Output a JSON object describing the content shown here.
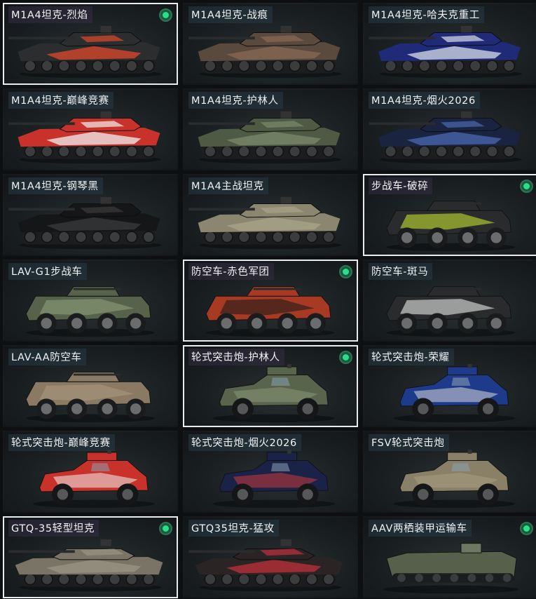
{
  "vehicles": [
    {
      "label": "M1A4坦克-烈焰",
      "selected": true,
      "owned": true,
      "type": "tank",
      "body": "#2b2d2f",
      "accent": "#e0482b",
      "icon": "tank-icon"
    },
    {
      "label": "M1A4坦克-战痕",
      "selected": false,
      "owned": false,
      "type": "tank",
      "body": "#5a4a3e",
      "accent": "#8a6a55",
      "icon": "tank-icon"
    },
    {
      "label": "M1A4坦克-哈夫克重工",
      "selected": false,
      "owned": false,
      "type": "tank",
      "body": "#1f2a78",
      "accent": "#d8dde8",
      "icon": "tank-icon"
    },
    {
      "label": "M1A4坦克-巅峰竞赛",
      "selected": false,
      "owned": false,
      "type": "tank",
      "body": "#c8322a",
      "accent": "#f0f0f0",
      "icon": "tank-icon"
    },
    {
      "label": "M1A4坦克-护林人",
      "selected": false,
      "owned": false,
      "type": "tank",
      "body": "#4f5a44",
      "accent": "#7a8a6a",
      "icon": "tank-icon"
    },
    {
      "label": "M1A4坦克-烟火2026",
      "selected": false,
      "owned": false,
      "type": "tank",
      "body": "#1a2340",
      "accent": "#4a6ab0",
      "icon": "tank-icon"
    },
    {
      "label": "M1A4坦克-钢琴黑",
      "selected": false,
      "owned": false,
      "type": "tank",
      "body": "#151617",
      "accent": "#3a3b3c",
      "icon": "tank-icon"
    },
    {
      "label": "M1A4主战坦克",
      "selected": false,
      "owned": false,
      "type": "tank",
      "body": "#8a8670",
      "accent": "#a8a488",
      "icon": "tank-icon"
    },
    {
      "label": "步战车-破碎",
      "selected": true,
      "owned": true,
      "type": "ifv",
      "body": "#2a2b2c",
      "accent": "#b8d030",
      "icon": "ifv-icon"
    },
    {
      "label": "LAV-G1步战车",
      "selected": false,
      "owned": false,
      "type": "ifv",
      "body": "#56624a",
      "accent": "#8a9a78",
      "icon": "ifv-icon"
    },
    {
      "label": "防空车-赤色军团",
      "selected": true,
      "owned": true,
      "type": "ifv",
      "body": "#a83a24",
      "accent": "#2a1e1a",
      "icon": "ifv-icon"
    },
    {
      "label": "防空车-斑马",
      "selected": false,
      "owned": false,
      "type": "ifv",
      "body": "#2a2b2c",
      "accent": "#d8d8d8",
      "icon": "ifv-icon"
    },
    {
      "label": "LAV-AA防空车",
      "selected": false,
      "owned": false,
      "type": "ifv",
      "body": "#8a7a64",
      "accent": "#a8967c",
      "icon": "ifv-icon"
    },
    {
      "label": "轮式突击炮-护林人",
      "selected": true,
      "owned": true,
      "type": "armored-car",
      "body": "#58644c",
      "accent": "#8a9878",
      "icon": "armored-car-icon"
    },
    {
      "label": "轮式突击炮-荣耀",
      "selected": false,
      "owned": false,
      "type": "armored-car",
      "body": "#1e3a8a",
      "accent": "#d8d8d8",
      "icon": "armored-car-icon"
    },
    {
      "label": "轮式突击炮-巅峰竞赛",
      "selected": false,
      "owned": false,
      "type": "armored-car",
      "body": "#c8322a",
      "accent": "#f0f0f0",
      "icon": "armored-car-icon"
    },
    {
      "label": "轮式突击炮-烟火2026",
      "selected": false,
      "owned": false,
      "type": "armored-car",
      "body": "#1a2248",
      "accent": "#c83a3a",
      "icon": "armored-car-icon"
    },
    {
      "label": "FSV轮式突击炮",
      "selected": false,
      "owned": false,
      "type": "armored-car",
      "body": "#8a8068",
      "accent": "#a89c80",
      "icon": "armored-car-icon"
    },
    {
      "label": "GTQ-35轻型坦克",
      "selected": true,
      "owned": true,
      "type": "light-tank",
      "body": "#7a7466",
      "accent": "#9a9484",
      "icon": "light-tank-icon"
    },
    {
      "label": "GTQ35坦克-猛攻",
      "selected": false,
      "owned": false,
      "type": "light-tank",
      "body": "#2a2425",
      "accent": "#c0303a",
      "icon": "light-tank-icon"
    },
    {
      "label": "AAV两栖装甲运输车",
      "selected": false,
      "owned": true,
      "type": "amphibious",
      "body": "#56604a",
      "accent": "#6e7860",
      "icon": "amphibious-vehicle-icon"
    }
  ],
  "colors": {
    "selected_border": "#e9ecee",
    "owned_dot": "#27e08a",
    "label_bg": "#283a46"
  }
}
